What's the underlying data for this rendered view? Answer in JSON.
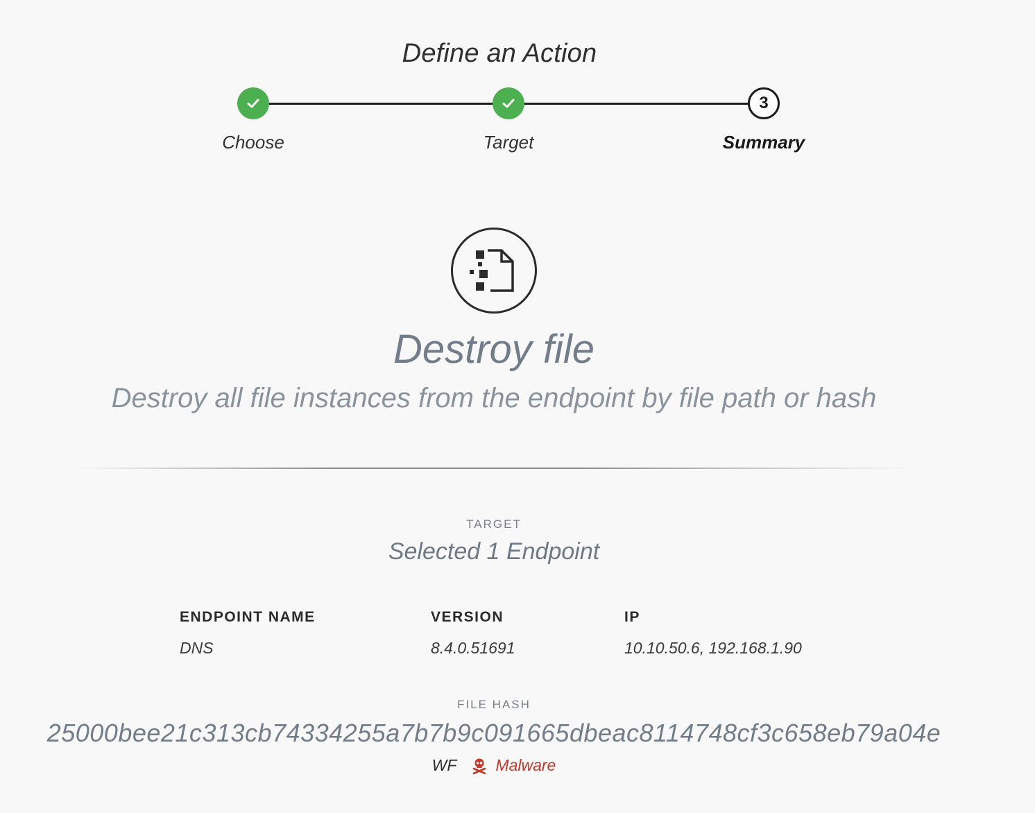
{
  "header": {
    "title": "Define an Action"
  },
  "stepper": {
    "steps": [
      {
        "label": "Choose",
        "state": "complete",
        "icon": "check-icon"
      },
      {
        "label": "Target",
        "state": "complete",
        "icon": "check-icon"
      },
      {
        "label": "Summary",
        "state": "current",
        "number": "3"
      }
    ]
  },
  "action": {
    "icon": "destroy-file-icon",
    "title": "Destroy file",
    "description": "Destroy all file instances from the endpoint by file path or hash"
  },
  "target": {
    "label": "TARGET",
    "value": "Selected 1 Endpoint"
  },
  "endpoint_table": {
    "columns": [
      "ENDPOINT NAME",
      "VERSION",
      "IP"
    ],
    "rows": [
      {
        "name": "DNS",
        "version": "8.4.0.51691",
        "ip": "10.10.50.6, 192.168.1.90"
      }
    ]
  },
  "file_hash": {
    "label": "FILE HASH",
    "value": "25000bee21c313cb74334255a7b7b9c091665dbeac8114748cf3c658eb79a04e",
    "source": "WF",
    "verdict": "Malware",
    "verdict_icon": "skull-crossbones-icon",
    "verdict_color": "#c0392b"
  },
  "colors": {
    "step_complete": "#4caf50",
    "text_muted": "#737d8a"
  }
}
